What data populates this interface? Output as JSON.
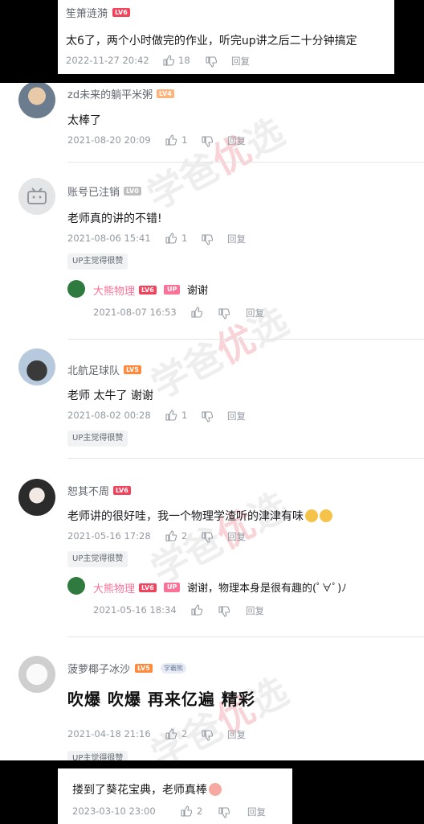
{
  "top_comment": {
    "user": "笙箫涟漪",
    "level": "LV6",
    "text": "太6了，两个小时做完的作业，听完up讲之后二十分钟搞定",
    "time": "2022-11-27 20:42",
    "likes": "18",
    "reply": "回复"
  },
  "comments": [
    {
      "user": "zd未来的躺平米粥",
      "level": "LV4",
      "text": "太棒了",
      "time": "2021-08-20 20:09",
      "likes": "1",
      "reply": "回复"
    },
    {
      "user": "账号已注销",
      "level": "LV0",
      "text": "老师真的讲的不错!",
      "time": "2021-08-06 15:41",
      "likes": "1",
      "reply": "回复",
      "tag": "UP主觉得很赞",
      "sub": {
        "user": "大熊物理",
        "level": "LV6",
        "badge": "UP",
        "text": "谢谢",
        "time": "2021-08-07 16:53",
        "reply": "回复"
      }
    },
    {
      "user": "北航足球队",
      "level": "LV5",
      "text": "老师 太牛了 谢谢",
      "time": "2021-08-02 00:28",
      "likes": "1",
      "reply": "回复",
      "tag": "UP主觉得很赞"
    },
    {
      "user": "恕其不周",
      "level": "LV6",
      "text": "老师讲的很好哇，我一个物理学渣听的津津有味",
      "time": "2021-05-16 17:28",
      "likes": "2",
      "reply": "回复",
      "tag": "UP主觉得很赞",
      "sub": {
        "user": "大熊物理",
        "level": "LV6",
        "badge": "UP",
        "text": "谢谢，物理本身是很有趣的(ﾟ∀ﾟ)ﾉ",
        "time": "2021-05-16 18:34",
        "reply": "回复"
      }
    },
    {
      "user": "菠萝椰子冰沙",
      "level": "LV5",
      "medal": "学霸熊",
      "text": "吹爆 吹爆 再来亿遍 精彩",
      "time": "2021-04-18 21:16",
      "likes": "2",
      "reply": "回复",
      "tag": "UP主觉得很赞"
    }
  ],
  "bottom_comment": {
    "text": "搂到了葵花宝典，老师真棒",
    "time": "2023-03-10 23:00",
    "likes": "2",
    "reply": "回复"
  },
  "watermark": {
    "part1": "学爸",
    "part2": "优",
    "part3": "选"
  }
}
